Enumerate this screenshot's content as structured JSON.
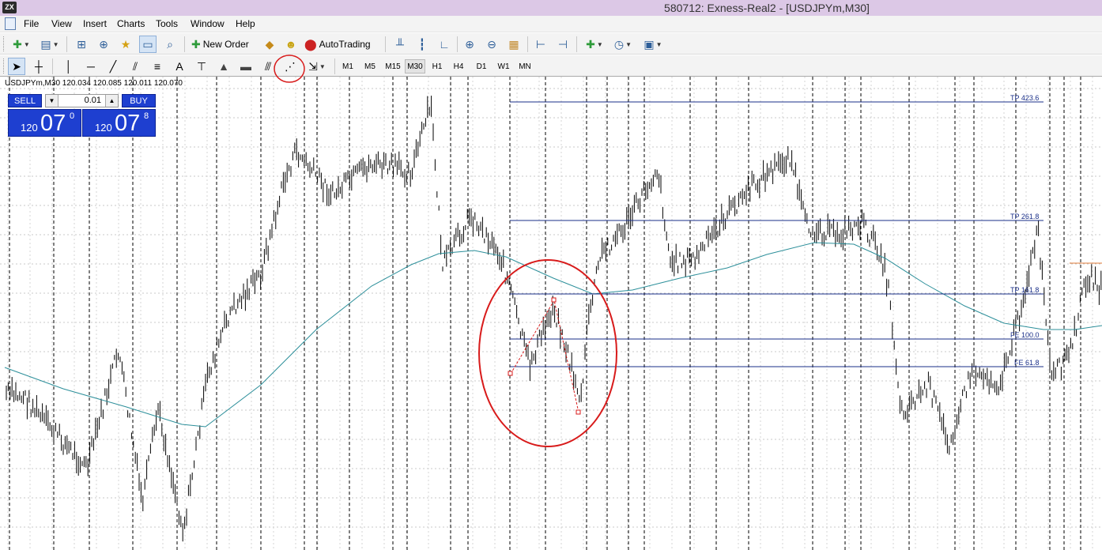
{
  "window": {
    "title": "580712: Exness-Real2 - [USDJPYm,M30]",
    "icon": "mt4-logo-icon",
    "icon_text": "ZX"
  },
  "menu": [
    "File",
    "View",
    "Insert",
    "Charts",
    "Tools",
    "Window",
    "Help"
  ],
  "toolbar": {
    "new_order_label": "New Order",
    "autotrading_label": "AutoTrading"
  },
  "timeframes": [
    "M1",
    "M5",
    "M15",
    "M30",
    "H1",
    "H4",
    "D1",
    "W1",
    "MN"
  ],
  "active_timeframe": "M30",
  "chart_info": "USDJPYm,M30  120.034 120.085 120.011 120.070",
  "trade_panel": {
    "sell_label": "SELL",
    "buy_label": "BUY",
    "lot": "0.01",
    "bid": {
      "small": "120",
      "big": "07",
      "sup": "0"
    },
    "ask": {
      "small": "120",
      "big": "07",
      "sup": "8"
    }
  },
  "fibo_labels": [
    "TP 423.6",
    "TP 261.8",
    "TP 161.8",
    "FE 100.0",
    "FE 61.8"
  ],
  "colors": {
    "title_bg": "#dcc8e6",
    "panel_blue": "#1e3fd0",
    "fibo_line": "#1a2f88",
    "ma_line": "#2c8f9a",
    "annotation": "#d81b1b"
  }
}
